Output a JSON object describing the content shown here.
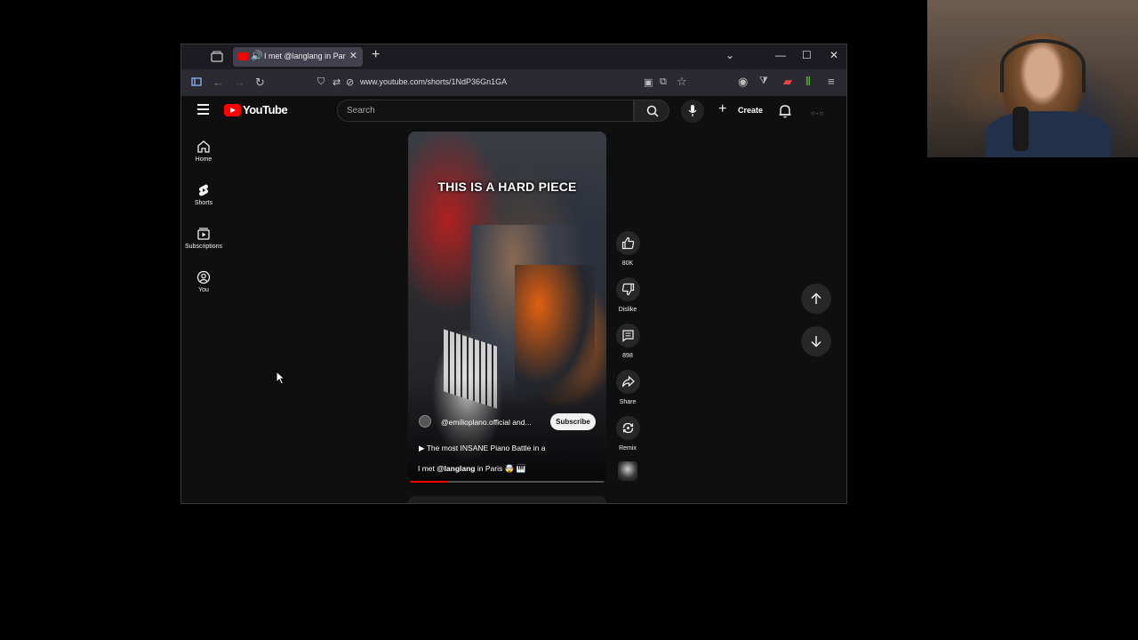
{
  "browser": {
    "tab_title": "I met @langlang in Paris 🤯",
    "url": "www.youtube.com/shorts/1NdP36Gn1GA"
  },
  "youtube": {
    "logo_text": "YouTube",
    "search_placeholder": "Search",
    "create_label": "Create",
    "sidebar": [
      {
        "label": "Home",
        "icon": "home-icon"
      },
      {
        "label": "Shorts",
        "icon": "shorts-icon"
      },
      {
        "label": "Subscriptions",
        "icon": "subscriptions-icon"
      },
      {
        "label": "You",
        "icon": "you-icon"
      }
    ]
  },
  "short": {
    "overlay_caption": "THIS IS A HARD PIECE",
    "channel": "@emilioplano.official and...",
    "subscribe_label": "Subscribe",
    "description_line1": "▶ The most INSANE Piano Battle in a",
    "title_prefix": "I met ",
    "title_handle": "@langlang",
    "title_suffix": " in Paris 🤯 🎹",
    "progress_fraction": 0.2
  },
  "actions": {
    "like_count": "80K",
    "dislike_label": "Dislike",
    "comments_count": "898",
    "share_label": "Share",
    "remix_label": "Remix"
  },
  "colors": {
    "youtube_red": "#ff0000",
    "background": "#0f0f0f",
    "button_bg": "#272727"
  }
}
